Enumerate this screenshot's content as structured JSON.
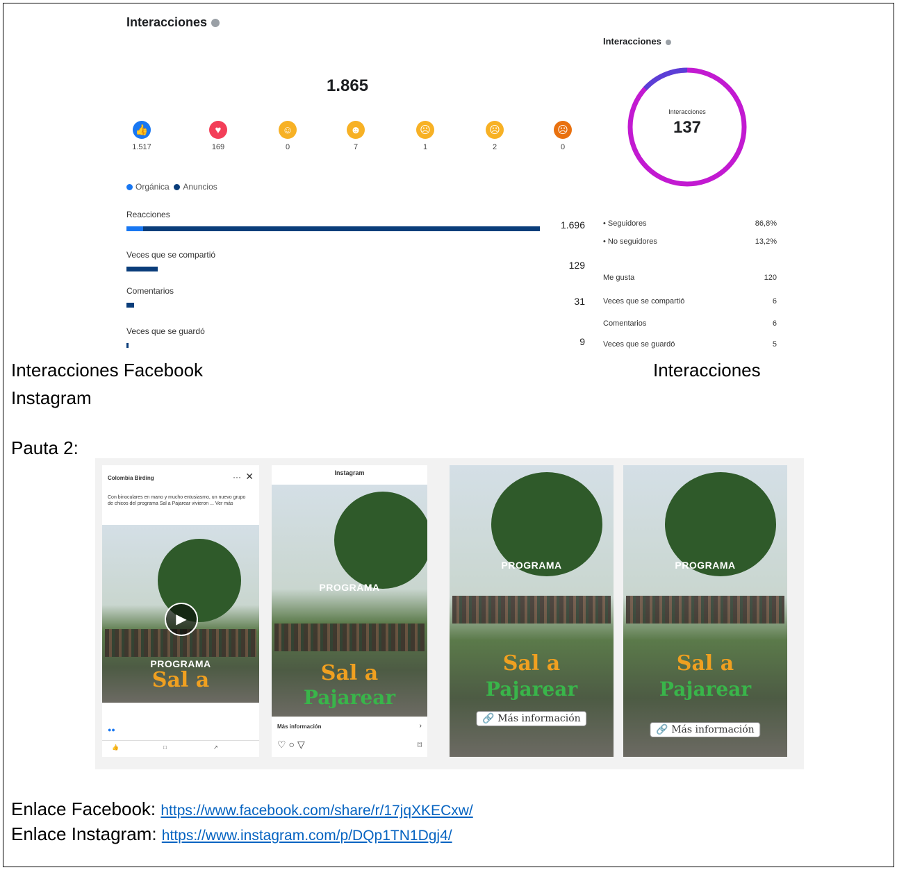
{
  "facebook": {
    "title": "Interacciones",
    "total": "1.865",
    "reactions": [
      {
        "name": "like",
        "value": "1.517",
        "color": "#1877f2",
        "glyph": "👍"
      },
      {
        "name": "love",
        "value": "169",
        "color": "#f33e58",
        "glyph": "♥"
      },
      {
        "name": "care",
        "value": "0",
        "color": "#f7b125",
        "glyph": "☺"
      },
      {
        "name": "haha",
        "value": "7",
        "color": "#f7b125",
        "glyph": "☻"
      },
      {
        "name": "wow",
        "value": "1",
        "color": "#f7b125",
        "glyph": "☹"
      },
      {
        "name": "sad",
        "value": "2",
        "color": "#f7b125",
        "glyph": "☹"
      },
      {
        "name": "angry",
        "value": "0",
        "color": "#e9710f",
        "glyph": "☹"
      }
    ],
    "legend": {
      "organic": "Orgánica",
      "ads": "Anuncios",
      "organic_color": "#1877f2",
      "ads_color": "#0a3d7a"
    },
    "metrics": [
      {
        "label": "Reacciones",
        "value": "1.696",
        "amount": 1696,
        "organic_fraction": 0.04
      },
      {
        "label": "Veces que se compartió",
        "value": "129",
        "amount": 129,
        "organic_fraction": 0
      },
      {
        "label": "Comentarios",
        "value": "31",
        "amount": 31,
        "organic_fraction": 0
      },
      {
        "label": "Veces que se guardó",
        "value": "9",
        "amount": 9,
        "organic_fraction": 0
      }
    ]
  },
  "instagram": {
    "title": "Interacciones",
    "ring_label": "Interacciones",
    "ring_value": "137",
    "followers_share": 0.868,
    "audience": [
      {
        "label": "• Seguidores",
        "value": "86,8%"
      },
      {
        "label": "• No seguidores",
        "value": "13,2%"
      }
    ],
    "metrics": [
      {
        "label": "Me gusta",
        "value": "120"
      },
      {
        "label": "Veces que se compartió",
        "value": "6"
      },
      {
        "label": "Comentarios",
        "value": "6"
      },
      {
        "label": "Veces que se guardó",
        "value": "5"
      }
    ]
  },
  "captions": {
    "facebook": "Interacciones Facebook",
    "instagram_right": "Interacciones",
    "instagram_left": "Instagram",
    "pauta": "Pauta 2:"
  },
  "screens": {
    "program": "PROGRAMA",
    "sal": "Sal a",
    "pajarear": "Pajarear",
    "more_info": "Más información",
    "instagram_header": "Instagram",
    "ig_more_info": "Más información",
    "fb_post_author": "Colombia Birding",
    "fb_post_text": "Con binoculares en mano y mucho entusiasmo, un nuevo grupo de chicos del programa Sal a Pajarear vivieron ... Ver más"
  },
  "links": {
    "facebook_label": "Enlace Facebook:",
    "facebook_url": "https://www.facebook.com/share/r/17jqXKECxw/",
    "instagram_label": "Enlace Instagram:",
    "instagram_url": "https://www.instagram.com/p/DQp1TN1Dgj4/"
  }
}
